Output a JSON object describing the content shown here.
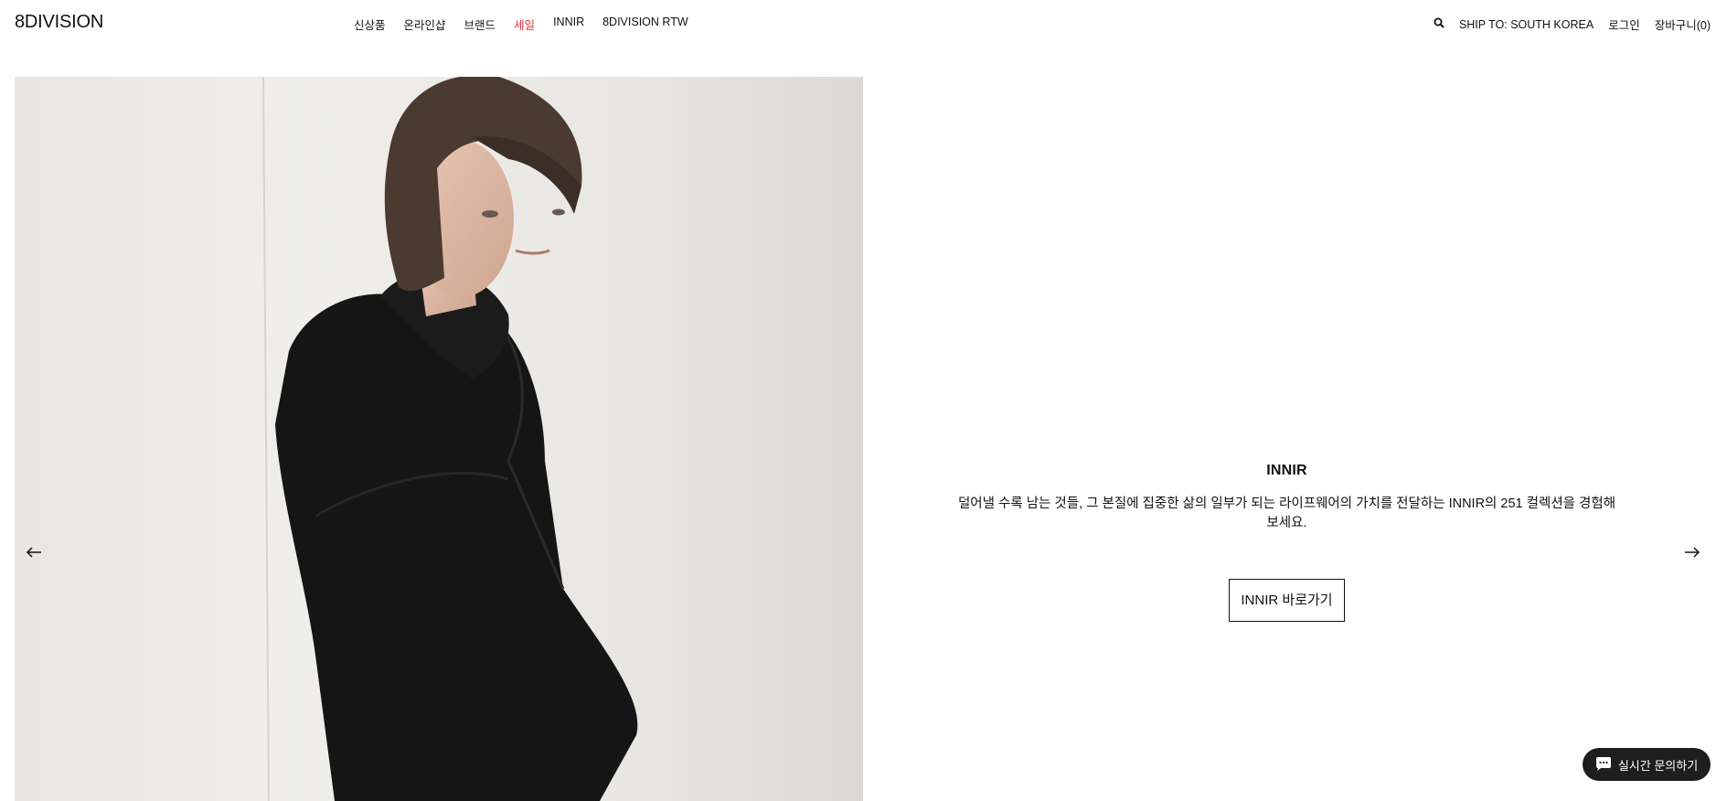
{
  "header": {
    "logo": "8DIVISION",
    "nav": [
      {
        "label": "신상품",
        "name": "nav-new-arrivals"
      },
      {
        "label": "온라인샵",
        "name": "nav-online-shop"
      },
      {
        "label": "브랜드",
        "name": "nav-brand"
      },
      {
        "label": "세일",
        "name": "nav-sale"
      },
      {
        "label": "INNIR",
        "name": "nav-innir"
      },
      {
        "label": "8DIVISION RTW",
        "name": "nav-rtw"
      }
    ],
    "ship_to": "SHIP TO: SOUTH KOREA",
    "login": "로그인",
    "cart": "장바구니(0)"
  },
  "hero": {
    "title": "INNIR",
    "description": "덜어낼 수록 남는 것들, 그 본질에 집중한 삶의 일부가 되는 라이프웨어의 가치를 전달하는 INNIR의 251 컬렉션을 경험해 보세요.",
    "cta": "INNIR 바로가기"
  },
  "chat": {
    "label": "실시간 문의하기"
  },
  "colors": {
    "sale": "#e0303a",
    "chat_bg": "#1e1e1e"
  }
}
